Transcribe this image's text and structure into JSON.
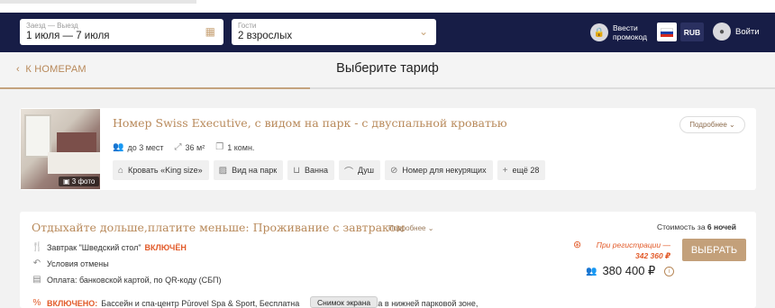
{
  "search": {
    "dates_label": "Заезд — Выезд",
    "dates_value": "1 июля — 7 июля",
    "guests_label": "Гости",
    "guests_value": "2 взрослых"
  },
  "header": {
    "promo_label": "Ввести промокод",
    "currency": "RUB",
    "login_label": "Войти"
  },
  "nav": {
    "back_label": "К НОМЕРАМ",
    "title": "Выберите тариф",
    "progress_fraction": 0.4
  },
  "room": {
    "title": "Номер Swiss Executive, с видом на парк - с двуспальной кроватью",
    "more_label": "Подробнее",
    "photo_count": "3 фото",
    "stats": [
      "до 3 мест",
      "36 м²",
      "1 комн."
    ],
    "amenities": [
      {
        "icon": "bed-icon",
        "label": "Кровать «King size»"
      },
      {
        "icon": "park-view-icon",
        "label": "Вид на парк"
      },
      {
        "icon": "bathtub-icon",
        "label": "Ванна"
      },
      {
        "icon": "shower-icon",
        "label": "Душ"
      },
      {
        "icon": "no-smoking-icon",
        "label": "Номер для некурящих"
      },
      {
        "icon": "plus-icon",
        "label": "ещё 28"
      }
    ]
  },
  "rate": {
    "title": "Отдыхайте дольше,платите меньше: Проживание с завтраком",
    "more_label": "Подробнее",
    "breakfast": "Завтрак \"Шведский стол\"",
    "breakfast_status": "ВКЛЮЧЁН",
    "cancellation": "Условия отмены",
    "payment": "Оплата: банковской картой, по QR-коду (СБП)",
    "included_prefix": "ВКЛЮЧЕНО:",
    "included_text": "Бассейн и спа-центр Pūrovel Spa & Sport, Бесплатна",
    "included_tail": "ка в нижней парковой зоне,",
    "cost_prefix": "Стоимость за",
    "cost_nights": "6 ночей",
    "reg_label": "При регистрации —",
    "reg_price": "342 360 ₽",
    "price": "380 400 ₽",
    "select_label": "ВЫБРАТЬ"
  },
  "tooltip": {
    "label": "Снимок экрана"
  },
  "colors": {
    "header_bg": "#171d46",
    "accent": "#b8895a",
    "button": "#c3a07a",
    "highlight": "#e25b2a"
  }
}
